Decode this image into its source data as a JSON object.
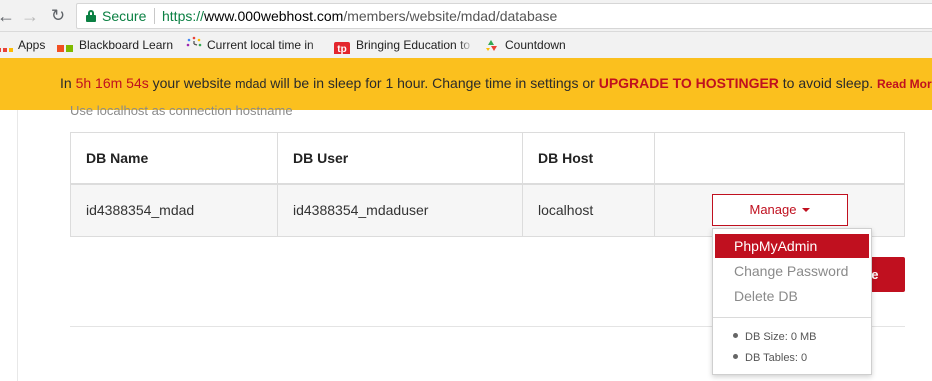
{
  "browser": {
    "secure_label": "Secure",
    "url_proto": "https://",
    "url_host": "www.000webhost.com",
    "url_path": "/members/website/mdad/database"
  },
  "bookmarks": [
    {
      "label": "Apps",
      "icon": "apps-grid-icon"
    },
    {
      "label": "Blackboard Learn",
      "icon": "blackboard-icon"
    },
    {
      "label": "Current local time in",
      "icon": "clock-icon"
    },
    {
      "label": "Bringing Education to",
      "icon": "tp-icon"
    },
    {
      "label": "Countdown",
      "icon": "countdown-icon"
    }
  ],
  "banner": {
    "pre": "In ",
    "time": "5h 16m 54s",
    "mid1": " your website ",
    "site": "mdad",
    "mid2": " will be in sleep for 1 hour. Change time in settings or ",
    "upgrade": "UPGRADE TO HOSTINGER",
    "post": " to avoid sleep. ",
    "read_more": "Read More"
  },
  "hint": "Use localhost as connection hostname",
  "table": {
    "headers": [
      "DB Name",
      "DB User",
      "DB Host",
      ""
    ],
    "rows": [
      {
        "name": "id4388354_mdad",
        "user": "id4388354_mdaduser",
        "host": "localhost"
      }
    ]
  },
  "manage_label": "Manage",
  "partial_button_text": "se",
  "dropdown": {
    "items": [
      "PhpMyAdmin",
      "Change Password",
      "Delete DB"
    ],
    "db_size": "DB Size: 0 MB",
    "db_tables": "DB Tables: 0"
  },
  "colors": {
    "accent_red": "#c0101f",
    "banner_yellow": "#fbc01e",
    "secure_green": "#0b8043"
  }
}
